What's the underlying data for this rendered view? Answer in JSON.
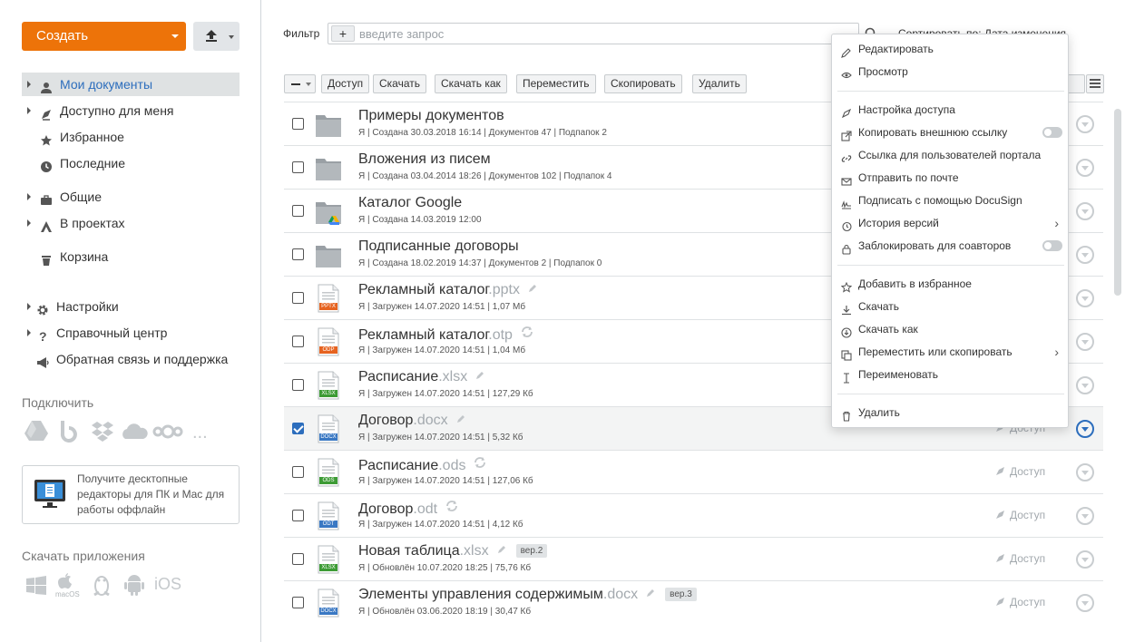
{
  "sidebar": {
    "create_label": "Создать",
    "nav": [
      {
        "label": "Мои документы",
        "icon": "user-icon",
        "active": true
      },
      {
        "label": "Доступно для меня",
        "icon": "share-icon"
      },
      {
        "label": "Избранное",
        "icon": "star-icon"
      },
      {
        "label": "Последние",
        "icon": "clock-icon"
      },
      {
        "label": "Общие",
        "icon": "briefcase-icon"
      },
      {
        "label": "В проектах",
        "icon": "projects-icon"
      },
      {
        "label": "Корзина",
        "icon": "trash-icon"
      }
    ],
    "nav2": [
      {
        "label": "Настройки",
        "icon": "gear-icon"
      },
      {
        "label": "Справочный центр",
        "icon": "question-icon"
      },
      {
        "label": "Обратная связь и поддержка",
        "icon": "megaphone-icon"
      }
    ],
    "connect_title": "Подключить",
    "connect_more": "...",
    "promo_text": "Получите десктопные редакторы для ПК и Mac для работы оффлайн",
    "apps_title": "Скачать приложения",
    "apps": {
      "macos_label": "macOS",
      "ios_label": "iOS"
    }
  },
  "filter": {
    "label": "Фильтр",
    "plus": "+",
    "placeholder": "введите запрос",
    "sort_text": "Сортировать по: Дата изменения"
  },
  "toolbar": {
    "buttons": [
      "Доступ",
      "Скачать",
      "Скачать как",
      "Переместить",
      "Скопировать",
      "Удалить"
    ]
  },
  "files": [
    {
      "title": "Примеры документов",
      "ext": "",
      "kind": "folder",
      "meta": "Я | Создана 30.03.2018 16:14 | Документов 47 | Подпапок 2"
    },
    {
      "title": "Вложения из писем",
      "ext": "",
      "kind": "folder",
      "meta": "Я | Создана 03.04.2014 18:26 | Документов 102 | Подпапок 4"
    },
    {
      "title": "Каталог Google",
      "ext": "",
      "kind": "folder-google",
      "meta": "Я | Создана 14.03.2019 12:00"
    },
    {
      "title": "Подписанные договоры",
      "ext": "",
      "kind": "folder",
      "meta": "Я | Создана 18.02.2019 14:37 | Документов 2 | Подпапок 0"
    },
    {
      "title": "Рекламный каталог",
      "ext": ".pptx",
      "kind": "pptx",
      "badge": "PPTX",
      "tool": "edit",
      "meta": "Я | Загружен 14.07.2020 14:51 | 1,07 Мб"
    },
    {
      "title": "Рекламный каталог",
      "ext": ".otp",
      "kind": "odp",
      "badge": "ODP",
      "tool": "convert",
      "meta": "Я | Загружен 14.07.2020 14:51 | 1,04 Мб"
    },
    {
      "title": "Расписание",
      "ext": ".xlsx",
      "kind": "xlsx",
      "badge": "XLSX",
      "tool": "edit",
      "meta": "Я | Загружен 14.07.2020 14:51 | 127,29 Кб"
    },
    {
      "title": "Договор",
      "ext": ".docx",
      "kind": "docx",
      "badge": "DOCX",
      "tool": "edit",
      "selected": true,
      "access": "Доступ",
      "meta": "Я | Загружен 14.07.2020 14:51 | 5,32 Кб"
    },
    {
      "title": "Расписание",
      "ext": ".ods",
      "kind": "ods",
      "badge": "ODS",
      "tool": "convert",
      "access": "Доступ",
      "meta": "Я | Загружен 14.07.2020 14:51 | 127,06 Кб"
    },
    {
      "title": "Договор",
      "ext": ".odt",
      "kind": "odt",
      "badge": "ODT",
      "tool": "convert",
      "access": "Доступ",
      "meta": "Я | Загружен 14.07.2020 14:51 | 4,12 Кб"
    },
    {
      "title": "Новая таблица",
      "ext": ".xlsx",
      "kind": "xlsx",
      "badge": "XLSX",
      "tool": "edit",
      "version": "вер.2",
      "access": "Доступ",
      "meta": "Я | Обновлён 10.07.2020 18:25 | 75,76 Кб"
    },
    {
      "title": "Элементы управления содержимым",
      "ext": ".docx",
      "kind": "docx",
      "badge": "DOCX",
      "tool": "edit",
      "version": "вер.3",
      "access": "Доступ",
      "meta": "Я | Обновлён 03.06.2020 18:19 | 30,47 Кб"
    }
  ],
  "context_menu": [
    {
      "label": "Редактировать",
      "icon": "pencil-icon"
    },
    {
      "label": "Просмотр",
      "icon": "eye-icon"
    },
    {
      "sep": true
    },
    {
      "label": "Настройка доступа",
      "icon": "share-settings-icon"
    },
    {
      "label": "Копировать внешнюю ссылку",
      "icon": "external-link-icon",
      "toggle": true
    },
    {
      "label": "Ссылка для пользователей портала",
      "icon": "link-icon"
    },
    {
      "label": "Отправить по почте",
      "icon": "mail-icon"
    },
    {
      "label": "Подписать с помощью DocuSign",
      "icon": "signature-icon"
    },
    {
      "label": "История версий",
      "icon": "history-icon",
      "submenu": true
    },
    {
      "label": "Заблокировать для соавторов",
      "icon": "lock-icon",
      "toggle": true
    },
    {
      "sep": true
    },
    {
      "label": "Добавить в избранное",
      "icon": "star-outline-icon"
    },
    {
      "label": "Скачать",
      "icon": "download-icon"
    },
    {
      "label": "Скачать как",
      "icon": "download-as-icon"
    },
    {
      "label": "Переместить или скопировать",
      "icon": "copy-icon",
      "submenu": true
    },
    {
      "label": "Переименовать",
      "icon": "rename-icon"
    },
    {
      "sep": true
    },
    {
      "label": "Удалить",
      "icon": "trash-icon"
    }
  ],
  "colors": {
    "accent": "#ed7309",
    "link": "#2d6ebd"
  }
}
